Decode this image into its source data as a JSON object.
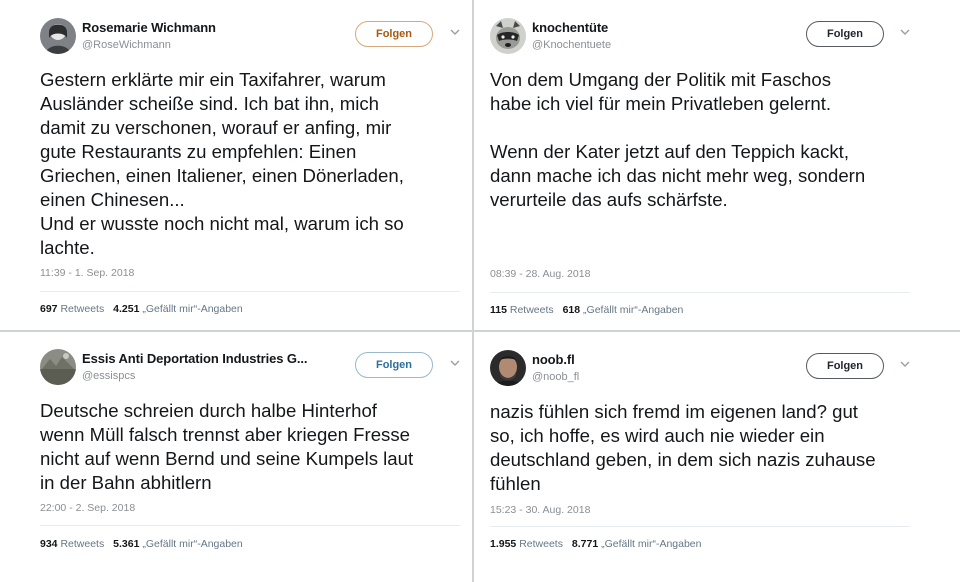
{
  "tweets": [
    {
      "name": "Rosemarie Wichmann",
      "handle": "@RoseWichmann",
      "follow_label": "Folgen",
      "text": [
        "Gestern erklärte mir ein Taxifahrer, warum",
        "Ausländer scheiße sind. Ich bat ihn, mich",
        "damit zu verschonen, worauf er anfing, mir",
        "gute Restaurants zu empfehlen: Einen",
        "Griechen, einen Italiener, einen Dönerladen,",
        "einen Chinesen...",
        "Und er wusste noch nicht mal, warum ich so",
        "lachte."
      ],
      "timestamp": "11:39 - 1. Sep. 2018",
      "retweets": "697",
      "retweets_label": "Retweets",
      "likes": "4.251",
      "likes_label": "„Gefällt mir“-Angaben",
      "avatar": "avatar-woman-grayscale",
      "follow_color": "#a85a10"
    },
    {
      "name": "knochentüte",
      "handle": "@Knochentuete",
      "follow_label": "Folgen",
      "text": [
        "Von dem Umgang der Politik mit Faschos",
        "habe ich viel für mein Privatleben gelernt.",
        "",
        "Wenn der Kater jetzt auf den Teppich kackt,",
        "dann mache ich das nicht mehr weg, sondern",
        "verurteile das aufs schärfste."
      ],
      "timestamp": "08:39 - 28. Aug. 2018",
      "retweets": "115",
      "retweets_label": "Retweets",
      "likes": "618",
      "likes_label": "„Gefällt mir“-Angaben",
      "avatar": "avatar-raccoon",
      "follow_color": "#22272c"
    },
    {
      "name": "Essis Anti Deportation Industries G...",
      "handle": "@essispcs",
      "follow_label": "Folgen",
      "text": [
        "Deutsche schreien durch halbe Hinterhof",
        "wenn Müll falsch trennst aber kriegen Fresse",
        "nicht auf wenn Bernd und seine Kumpels laut",
        "in der Bahn abhitlern"
      ],
      "timestamp": "22:00 - 2. Sep. 2018",
      "retweets": "934",
      "retweets_label": "Retweets",
      "likes": "5.361",
      "likes_label": "„Gefällt mir“-Angaben",
      "avatar": "avatar-landscape",
      "follow_color": "#2a6f9e"
    },
    {
      "name": "noob.fl",
      "handle": "@noob_fl",
      "follow_label": "Folgen",
      "text": [
        "nazis fühlen sich fremd im eigenen land? gut",
        "so, ich hoffe, es wird auch nie wieder ein",
        "deutschland geben, in dem sich nazis zuhause",
        "fühlen"
      ],
      "timestamp": "15:23 - 30. Aug. 2018",
      "retweets": "1.955",
      "retweets_label": "Retweets",
      "likes": "8.771",
      "likes_label": "„Gefällt mir“-Angaben",
      "avatar": "avatar-man-dark",
      "follow_color": "#22272c"
    }
  ]
}
